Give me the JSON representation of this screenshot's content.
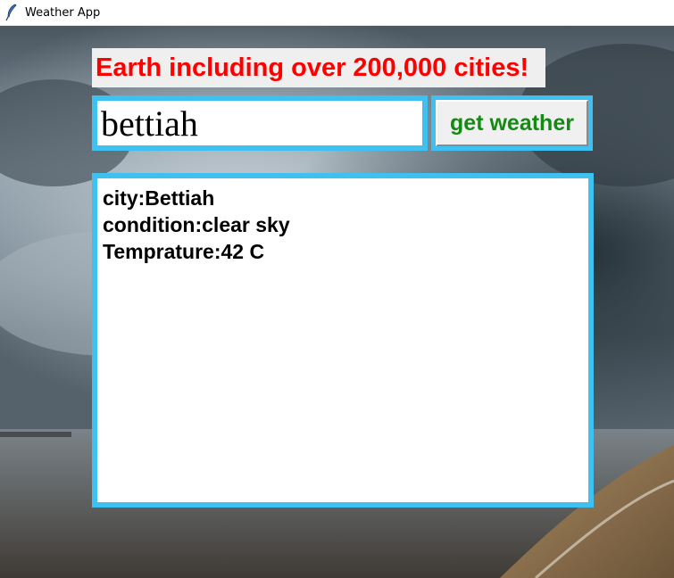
{
  "window": {
    "title": "Weather App"
  },
  "header": {
    "banner_text": "Earth including over 200,000 cities!"
  },
  "search": {
    "city_value": "bettiah",
    "button_label": "get weather"
  },
  "result": {
    "lines": [
      "city:Bettiah",
      "condition:clear sky",
      "Temprature:42 C"
    ]
  },
  "colors": {
    "banner_text": "#ff0000",
    "frame_accent": "#3ec1f0",
    "button_text": "#138a13"
  }
}
